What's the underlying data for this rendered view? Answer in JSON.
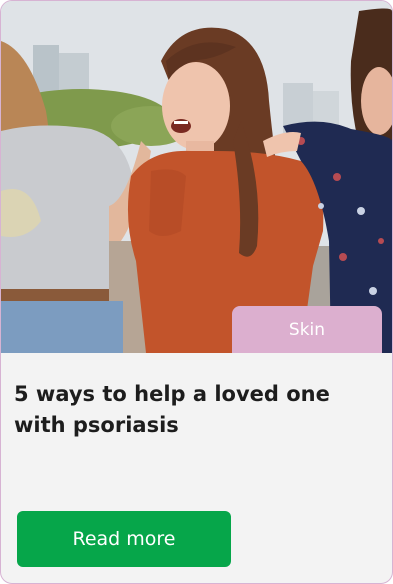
{
  "card": {
    "tag_label": "Skin",
    "title": "5 ways to help a loved one with psoriasis",
    "button_label": "Read more"
  },
  "colors": {
    "card_border": "#d7b3d3",
    "tag_background": "#dcafcf",
    "button_background": "#06a64a",
    "title_text": "#1d1d1d"
  }
}
